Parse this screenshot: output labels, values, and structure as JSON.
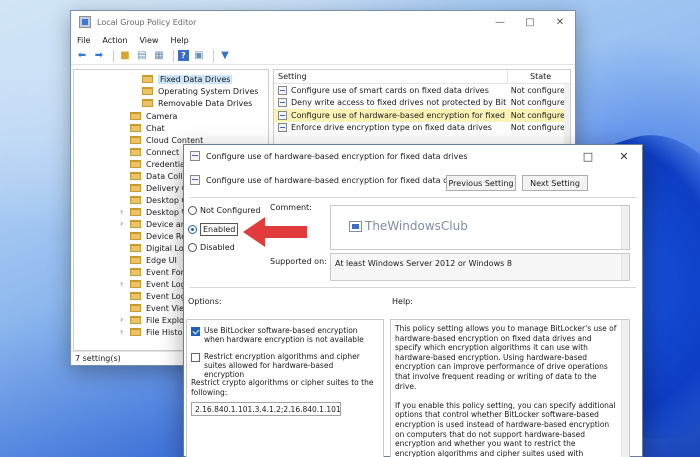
{
  "gpe": {
    "title": "Local Group Policy Editor",
    "menu": [
      "File",
      "Action",
      "View",
      "Help"
    ],
    "tree": [
      {
        "label": "Fixed Data Drives",
        "selected": true
      },
      {
        "label": "Operating System Drives"
      },
      {
        "label": "Removable Data Drives"
      },
      {
        "label": "Camera"
      },
      {
        "label": "Chat"
      },
      {
        "label": "Cloud Content"
      },
      {
        "label": "Connect"
      },
      {
        "label": "Credential U"
      },
      {
        "label": "Data Collec"
      },
      {
        "label": "Delivery Op"
      },
      {
        "label": "Desktop Ga"
      },
      {
        "label": "Desktop Wi"
      },
      {
        "label": "Device and"
      },
      {
        "label": "Device Regi"
      },
      {
        "label": "Digital Lock"
      },
      {
        "label": "Edge UI"
      },
      {
        "label": "Event Forw"
      },
      {
        "label": "Event Log S"
      },
      {
        "label": "Event Logg"
      },
      {
        "label": "Event View"
      },
      {
        "label": "File Explore"
      },
      {
        "label": "File History"
      }
    ],
    "list_headers": {
      "setting": "Setting",
      "state": "State"
    },
    "rows": [
      {
        "name": "Configure use of smart cards on fixed data drives",
        "state": "Not configured"
      },
      {
        "name": "Deny write access to fixed drives not protected by BitLocker",
        "state": "Not configured"
      },
      {
        "name": "Configure use of hardware-based encryption for fixed data ...",
        "state": "Not configured"
      },
      {
        "name": "Enforce drive encryption type on fixed data drives",
        "state": "Not configured"
      }
    ],
    "status": "7 setting(s)"
  },
  "dialog": {
    "title": "Configure use of hardware-based encryption for fixed data drives",
    "header": "Configure use of hardware-based encryption for fixed data drives",
    "prev_btn": "Previous Setting",
    "next_btn": "Next Setting",
    "radios": {
      "not_configured": "Not Configured",
      "enabled": "Enabled",
      "disabled": "Disabled"
    },
    "comment_label": "Comment:",
    "watermark": "TheWindowsClub",
    "supported_label": "Supported on:",
    "supported_value": "At least Windows Server 2012 or Windows 8",
    "options_label": "Options:",
    "help_label": "Help:",
    "opt_check1": "Use BitLocker software-based encryption when hardware encryption is not available",
    "opt_check2": "Restrict encryption algorithms and cipher suites allowed for hardware-based encryption",
    "opt_restrict_label": "Restrict crypto algorithms or cipher suites to the following:",
    "opt_value": "2.16.840.1.101.3.4.1.2;2.16.840.1.101.3.4.1.",
    "help_p1": "This policy setting allows you to manage BitLocker's use of hardware-based encryption on fixed data drives and specify which encryption algorithms it can use with hardware-based encryption. Using hardware-based encryption can improve performance of drive operations that involve frequent reading or writing of data to the drive.",
    "help_p2": "If you enable this policy setting, you can specify additional options that control whether BitLocker software-based encryption is used instead of hardware-based encryption on computers that do not support hardware-based encryption and whether you want to restrict the encryption algorithms and cipher suites used with hardware-based encryption."
  },
  "colors": {
    "accent": "#1b5fbf",
    "arrow": "#e23b3b",
    "highlight": "#fbf3b6"
  }
}
